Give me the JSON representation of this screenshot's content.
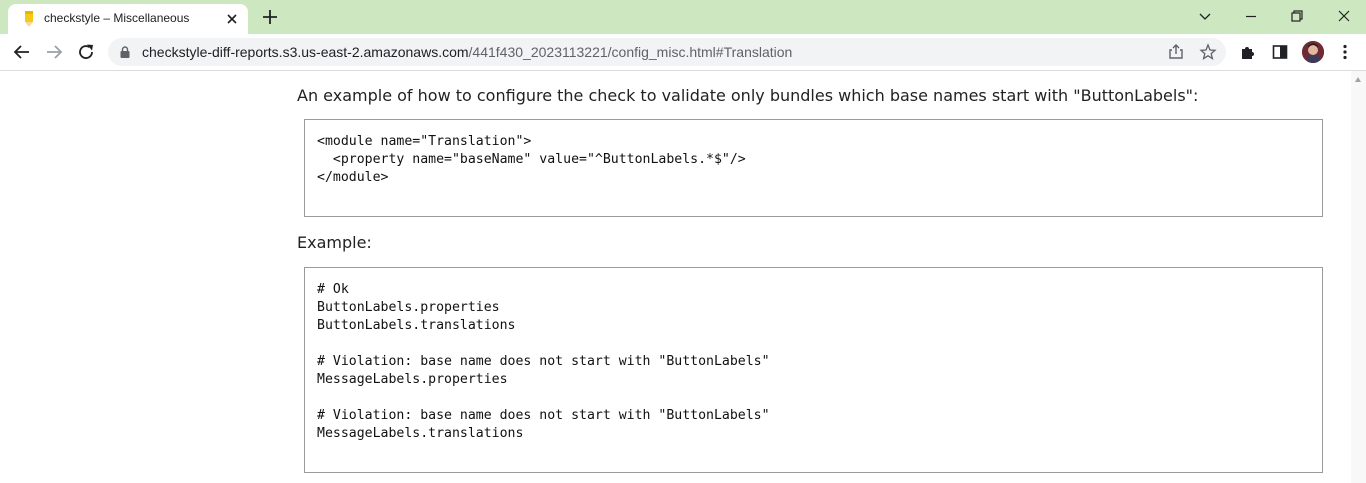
{
  "browser": {
    "tab": {
      "title": "checkstyle – Miscellaneous",
      "favicon": "pencil-favicon-icon"
    },
    "url": {
      "host": "checkstyle-diff-reports.s3.us-east-2.amazonaws.com",
      "path": "/441f430_2023113221/config_misc.html#Translation"
    },
    "colors": {
      "tabstrip": "#cde8c0",
      "omnibox": "#f1f3f4"
    }
  },
  "content": {
    "intro_text": "An example of how to configure the check to validate only bundles which base names start with \"ButtonLabels\":",
    "config_code": "<module name=\"Translation\">\n  <property name=\"baseName\" value=\"^ButtonLabels.*$\"/>\n</module>",
    "example_label": "Example:",
    "example_code": "# Ok\nButtonLabels.properties\nButtonLabels.translations\n\n# Violation: base name does not start with \"ButtonLabels\"\nMessageLabels.properties\n\n# Violation: base name does not start with \"ButtonLabels\"\nMessageLabels.translations"
  }
}
